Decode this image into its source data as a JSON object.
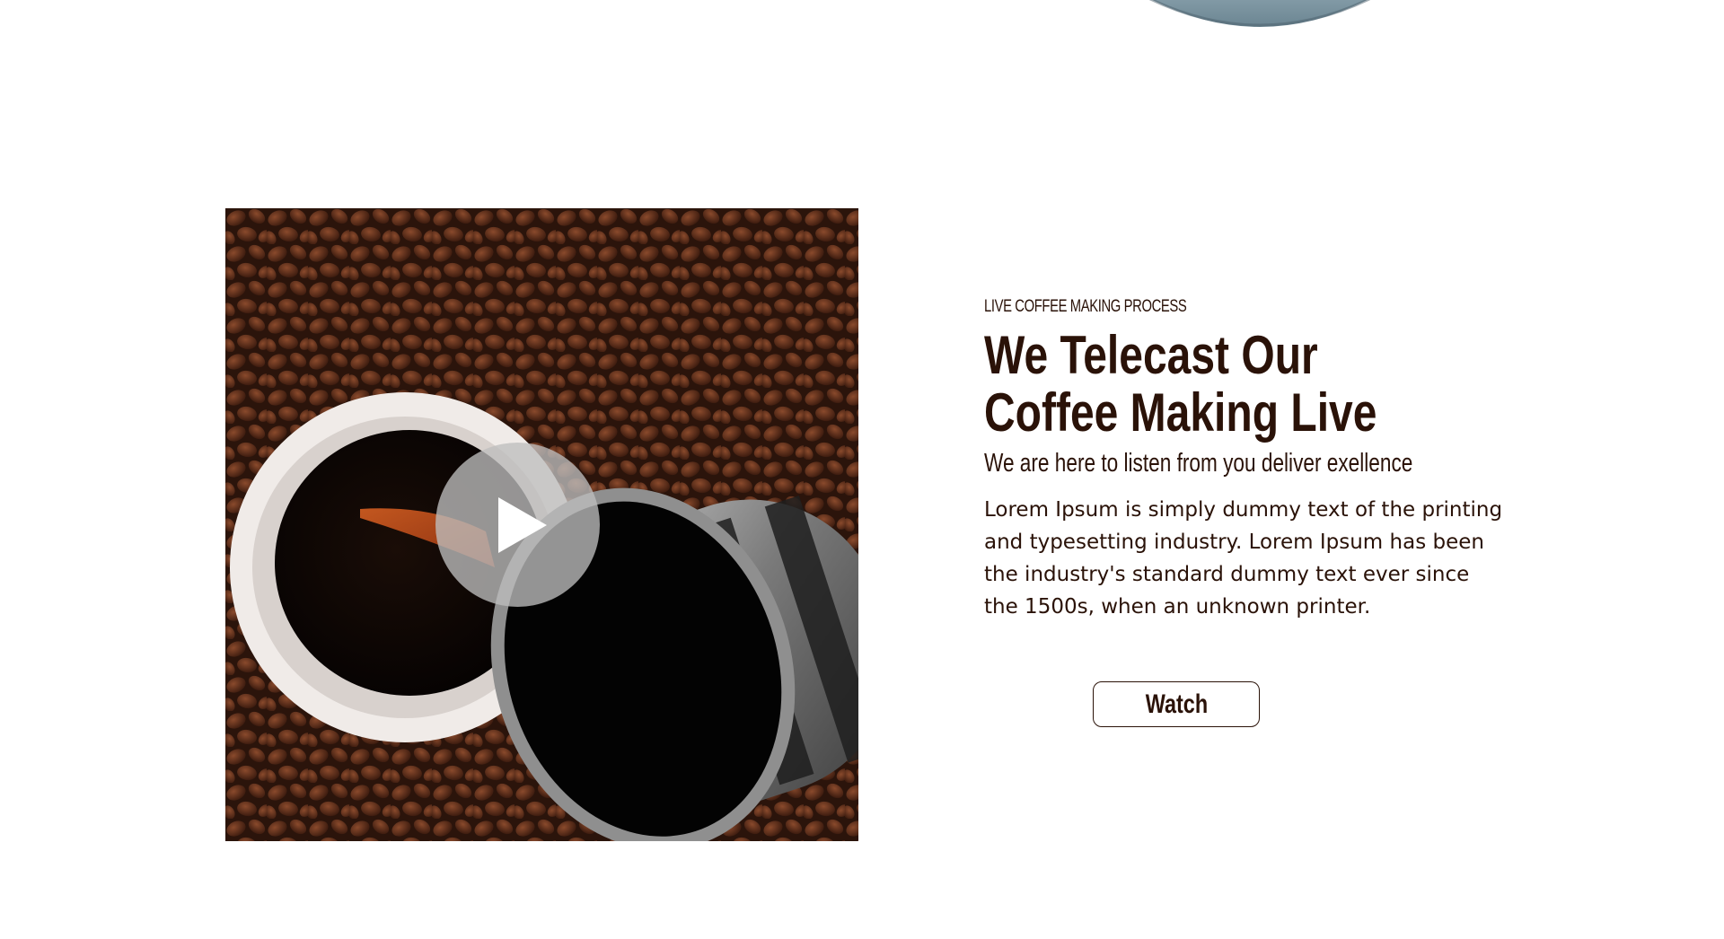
{
  "section": {
    "eyebrow": "LIVE COFFEE MAKING PROCESS",
    "headline_line1": "We Telecast Our",
    "headline_line2": "Coffee Making Live",
    "subhead": "We are here to listen from you deliver exellence",
    "body": "Lorem Ipsum is simply dummy text of the printing and typesetting industry. Lorem Ipsum has been the industry's standard dummy text ever since the 1500s, when an unknown printer.",
    "watch_label": "Watch"
  },
  "colors": {
    "text": "#2a1208",
    "background": "#ffffff",
    "play_overlay": "#bebebe"
  },
  "icons": {
    "play": "play-icon"
  }
}
